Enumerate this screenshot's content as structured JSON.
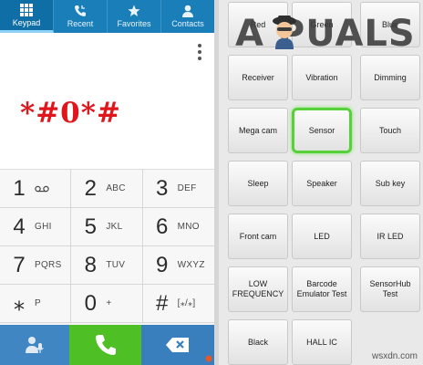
{
  "tabs": [
    {
      "label": "Keypad",
      "icon": "keypad-icon",
      "active": true
    },
    {
      "label": "Recent",
      "icon": "recent-calls-icon"
    },
    {
      "label": "Favorites",
      "icon": "star-icon"
    },
    {
      "label": "Contacts",
      "icon": "person-icon"
    }
  ],
  "dialer": {
    "dialed_number": "*#0*#",
    "dialed_color": "#e0161c"
  },
  "keypad": [
    {
      "digit": "1",
      "letters": "",
      "extra": "voicemail-icon"
    },
    {
      "digit": "2",
      "letters": "ABC"
    },
    {
      "digit": "3",
      "letters": "DEF"
    },
    {
      "digit": "4",
      "letters": "GHI"
    },
    {
      "digit": "5",
      "letters": "JKL"
    },
    {
      "digit": "6",
      "letters": "MNO"
    },
    {
      "digit": "7",
      "letters": "PQRS"
    },
    {
      "digit": "8",
      "letters": "TUV"
    },
    {
      "digit": "9",
      "letters": "WXYZ"
    },
    {
      "digit": "⁎",
      "letters": "P"
    },
    {
      "digit": "0",
      "letters": "+"
    },
    {
      "digit": "#",
      "letters": "[⁎/⁎]"
    }
  ],
  "actions": {
    "voice": "voice-dial-icon",
    "call": "phone-icon",
    "delete": "backspace-icon"
  },
  "test_menu": [
    {
      "label": "Red"
    },
    {
      "label": "Green"
    },
    {
      "label": "Blue"
    },
    {
      "label": "Receiver"
    },
    {
      "label": "Vibration"
    },
    {
      "label": "Dimming"
    },
    {
      "label": "Mega cam"
    },
    {
      "label": "Sensor",
      "highlighted": true
    },
    {
      "label": "Touch"
    },
    {
      "label": "Sleep"
    },
    {
      "label": "Speaker"
    },
    {
      "label": "Sub key"
    },
    {
      "label": "Front cam"
    },
    {
      "label": "LED"
    },
    {
      "label": "IR LED"
    },
    {
      "label": "LOW FREQUENCY"
    },
    {
      "label": "Barcode Emulator Test"
    },
    {
      "label": "SensorHub Test"
    },
    {
      "label": "Black"
    },
    {
      "label": "HALL IC"
    }
  ],
  "branding": {
    "logo_text": "A PUALS",
    "watermark": "wsxdn.com"
  }
}
